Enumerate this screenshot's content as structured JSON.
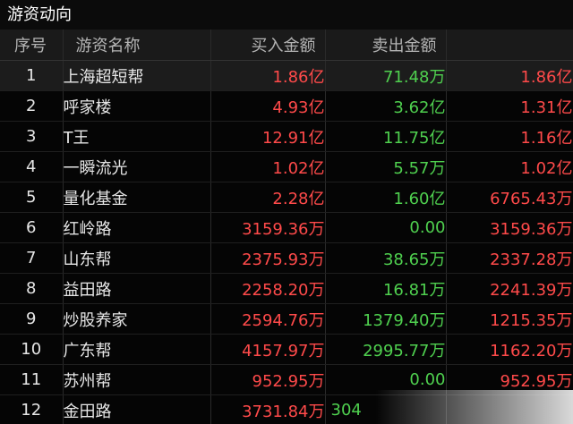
{
  "panel": {
    "title": "游资动向"
  },
  "columns": {
    "index": "序号",
    "name": "游资名称",
    "buy": "买入金额",
    "sell": "卖出金额",
    "net": ""
  },
  "colors": {
    "up": "#ff4a4a",
    "down": "#4fd04f",
    "background": "#050505"
  },
  "rows": [
    {
      "index": "1",
      "name": "上海超短帮",
      "buy": "1.86亿",
      "sell": "71.48万",
      "net": "1.86亿"
    },
    {
      "index": "2",
      "name": "呼家楼",
      "buy": "4.93亿",
      "sell": "3.62亿",
      "net": "1.31亿"
    },
    {
      "index": "3",
      "name": "T王",
      "buy": "12.91亿",
      "sell": "11.75亿",
      "net": "1.16亿"
    },
    {
      "index": "4",
      "name": "一瞬流光",
      "buy": "1.02亿",
      "sell": "5.57万",
      "net": "1.02亿"
    },
    {
      "index": "5",
      "name": "量化基金",
      "buy": "2.28亿",
      "sell": "1.60亿",
      "net": "6765.43万"
    },
    {
      "index": "6",
      "name": "红岭路",
      "buy": "3159.36万",
      "sell": "0.00",
      "net": "3159.36万"
    },
    {
      "index": "7",
      "name": "山东帮",
      "buy": "2375.93万",
      "sell": "38.65万",
      "net": "2337.28万"
    },
    {
      "index": "8",
      "name": "益田路",
      "buy": "2258.20万",
      "sell": "16.81万",
      "net": "2241.39万"
    },
    {
      "index": "9",
      "name": "炒股养家",
      "buy": "2594.76万",
      "sell": "1379.40万",
      "net": "1215.35万"
    },
    {
      "index": "10",
      "name": "广东帮",
      "buy": "4157.97万",
      "sell": "2995.77万",
      "net": "1162.20万"
    },
    {
      "index": "11",
      "name": "苏州帮",
      "buy": "952.95万",
      "sell": "0.00",
      "net": "952.95万"
    },
    {
      "index": "12",
      "name": "金田路",
      "buy": "3731.84万",
      "sell": "304",
      "net": ""
    }
  ]
}
